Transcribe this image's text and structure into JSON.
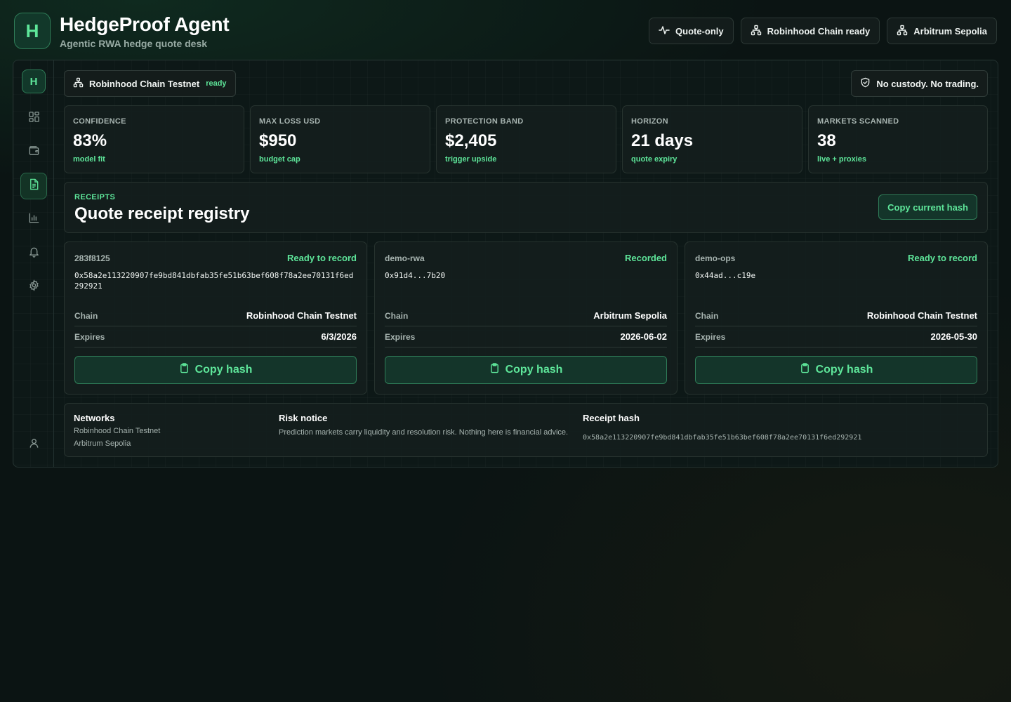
{
  "app": {
    "logo_letter": "H",
    "title": "HedgeProof Agent",
    "subtitle": "Agentic RWA hedge quote desk"
  },
  "header_chips": [
    {
      "label": "Quote-only",
      "icon": "activity-icon"
    },
    {
      "label": "Robinhood Chain ready",
      "icon": "network-icon"
    },
    {
      "label": "Arbitrum Sepolia",
      "icon": "network-icon"
    }
  ],
  "sidebar": {
    "logo_letter": "H",
    "items": [
      {
        "name": "dashboard",
        "icon": "grid-icon",
        "active": false
      },
      {
        "name": "wallet",
        "icon": "wallet-icon",
        "active": false
      },
      {
        "name": "receipts",
        "icon": "document-icon",
        "active": true
      },
      {
        "name": "analytics",
        "icon": "bar-chart-icon",
        "active": false
      },
      {
        "name": "alerts",
        "icon": "bell-icon",
        "active": false
      },
      {
        "name": "settings",
        "icon": "gear-icon",
        "active": false
      }
    ],
    "profile_icon": "user-icon"
  },
  "network_pill": {
    "label": "Robinhood Chain Testnet",
    "status": "ready"
  },
  "custody_pill": {
    "label": "No custody. No trading."
  },
  "stats": [
    {
      "label": "CONFIDENCE",
      "value": "83%",
      "note": "model fit"
    },
    {
      "label": "MAX LOSS USD",
      "value": "$950",
      "note": "budget cap"
    },
    {
      "label": "PROTECTION BAND",
      "value": "$2,405",
      "note": "trigger upside"
    },
    {
      "label": "HORIZON",
      "value": "21 days",
      "note": "quote expiry"
    },
    {
      "label": "MARKETS SCANNED",
      "value": "38",
      "note": "live + proxies"
    }
  ],
  "receipts_section": {
    "kicker": "RECEIPTS",
    "title": "Quote receipt registry",
    "copy_current_label": "Copy current hash"
  },
  "receipts": [
    {
      "id": "283f8125",
      "status": "Ready to record",
      "hash": "0x58a2e113220907fe9bd841dbfab35fe51b63bef608f78a2ee70131f6ed292921",
      "chain_label": "Chain",
      "chain": "Robinhood Chain Testnet",
      "expires_label": "Expires",
      "expires": "6/3/2026",
      "copy_label": "Copy hash"
    },
    {
      "id": "demo-rwa",
      "status": "Recorded",
      "hash": "0x91d4...7b20",
      "chain_label": "Chain",
      "chain": "Arbitrum Sepolia",
      "expires_label": "Expires",
      "expires": "2026-06-02",
      "copy_label": "Copy hash"
    },
    {
      "id": "demo-ops",
      "status": "Ready to record",
      "hash": "0x44ad...c19e",
      "chain_label": "Chain",
      "chain": "Robinhood Chain Testnet",
      "expires_label": "Expires",
      "expires": "2026-05-30",
      "copy_label": "Copy hash"
    }
  ],
  "footer": {
    "networks_title": "Networks",
    "networks": [
      "Robinhood Chain Testnet",
      "Arbitrum Sepolia"
    ],
    "risk_title": "Risk notice",
    "risk_text": "Prediction markets carry liquidity and resolution risk. Nothing here is financial advice.",
    "hash_title": "Receipt hash",
    "hash_value": "0x58a2e113220907fe9bd841dbfab35fe51b63bef608f78a2ee70131f6ed292921"
  },
  "colors": {
    "accent": "#5ee69a",
    "background": "#0b1413",
    "panel": "#141e1d",
    "border": "#27332f"
  }
}
